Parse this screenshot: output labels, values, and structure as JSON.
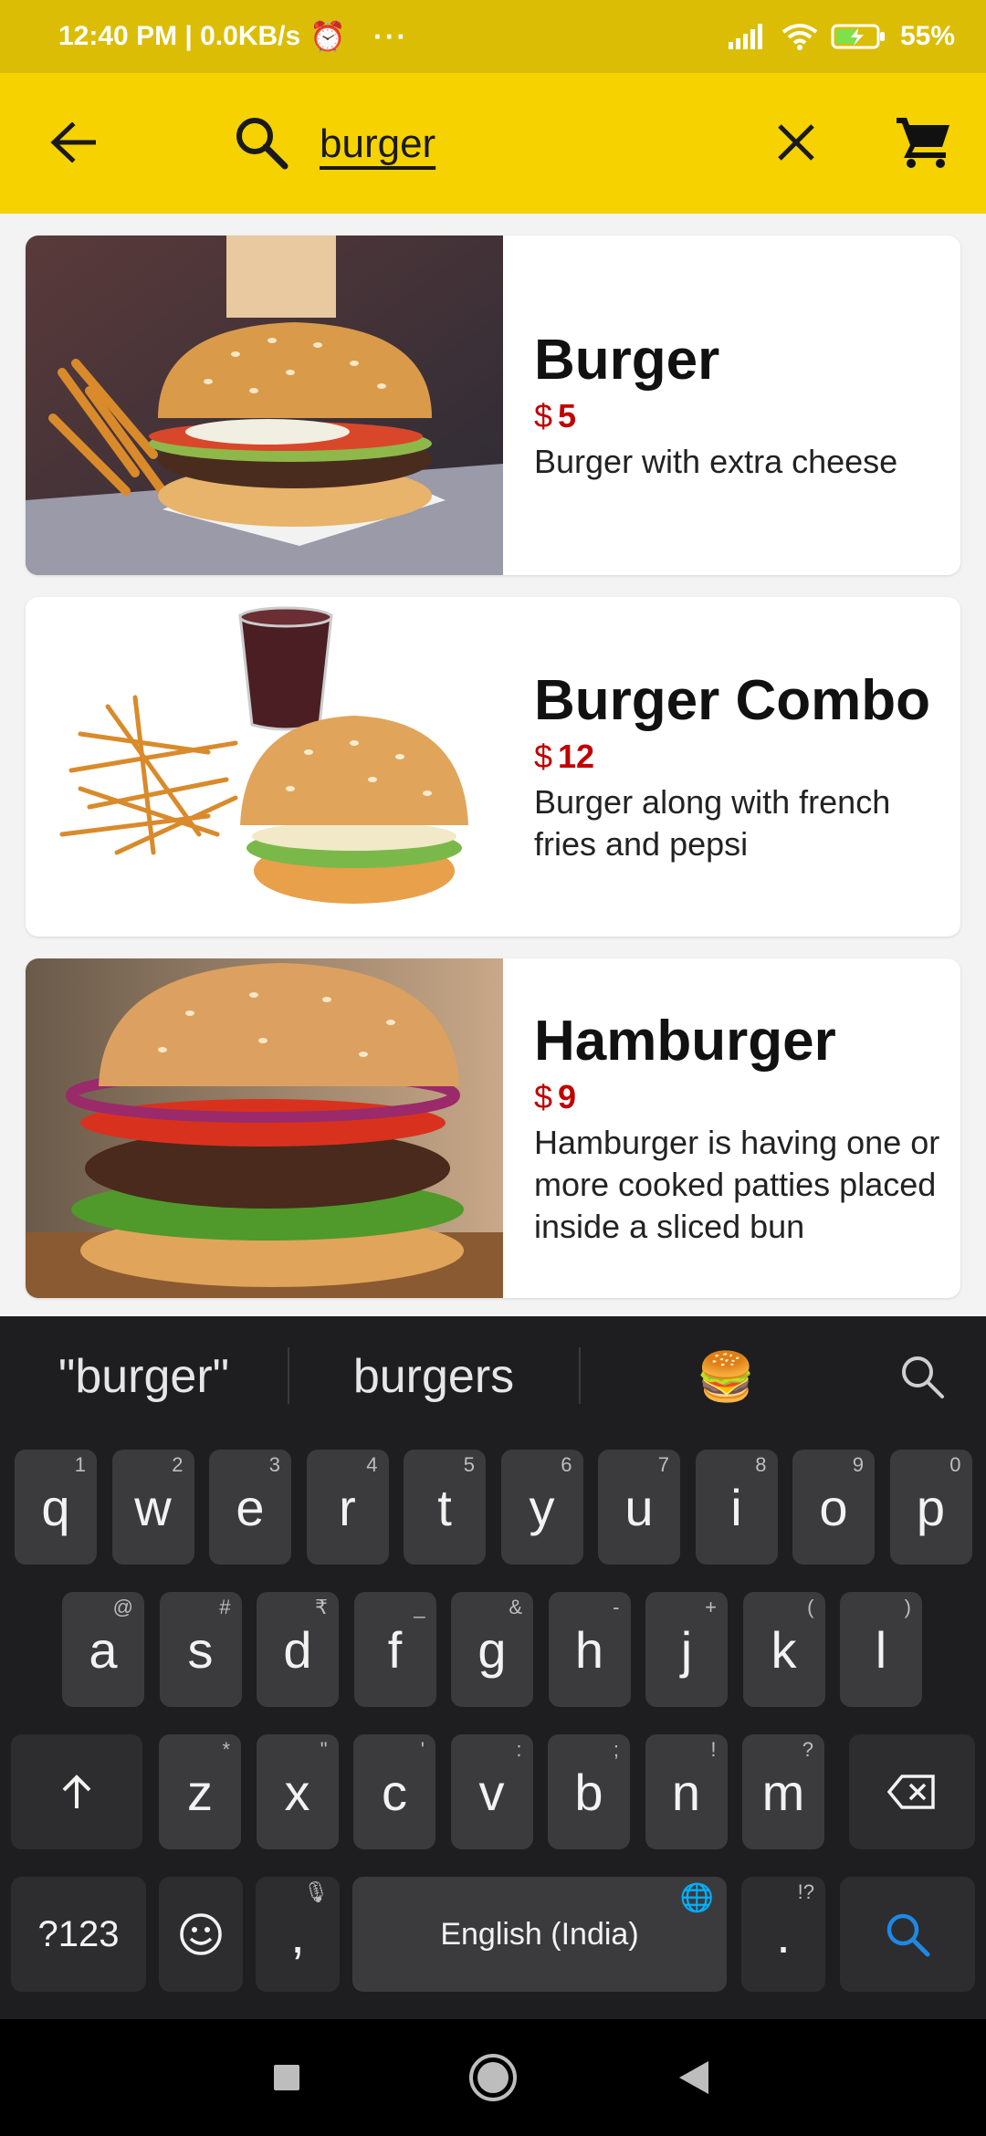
{
  "status_bar": {
    "time_speed": "12:40 PM | 0.0KB/s",
    "battery": "55%"
  },
  "search": {
    "query": "burger"
  },
  "products": [
    {
      "name": "Burger",
      "currency": "$",
      "price": "5",
      "description": "Burger with extra cheese"
    },
    {
      "name": "Burger Combo",
      "currency": "$",
      "price": "12",
      "description": "Burger along with french fries and pepsi"
    },
    {
      "name": "Hamburger",
      "currency": "$",
      "price": "9",
      "description": "Hamburger is having one or more cooked patties placed inside a sliced bun"
    }
  ],
  "keyboard": {
    "suggestions": [
      "\"burger\"",
      "burgers"
    ],
    "emoji": "🍔",
    "row1": [
      "q",
      "w",
      "e",
      "r",
      "t",
      "y",
      "u",
      "i",
      "o",
      "p"
    ],
    "row1_hints": [
      "1",
      "2",
      "3",
      "4",
      "5",
      "6",
      "7",
      "8",
      "9",
      "0"
    ],
    "row2": [
      "a",
      "s",
      "d",
      "f",
      "g",
      "h",
      "j",
      "k",
      "l"
    ],
    "row2_hints": [
      "@",
      "#",
      "₹",
      "_",
      "&",
      "-",
      "+",
      "(",
      ")"
    ],
    "row3": [
      "z",
      "x",
      "c",
      "v",
      "b",
      "n",
      "m"
    ],
    "row3_hints": [
      "*",
      "\"",
      "'",
      ":",
      ";",
      "!",
      "?"
    ],
    "symbols_label": "?123",
    "comma": ",",
    "period": ".",
    "period_hint": "!?",
    "space_label": "English (India)"
  },
  "colors": {
    "status_bar": "#dcbd06",
    "app_bar": "#f5d200",
    "price": "#c00000",
    "keyboard_bg": "#1e1e20",
    "key_bg": "#3b3b3d",
    "search_accent": "#1e88e5"
  },
  "icons": {
    "back": "arrow-left-icon",
    "search": "search-icon",
    "clear": "close-icon",
    "cart": "cart-icon"
  }
}
